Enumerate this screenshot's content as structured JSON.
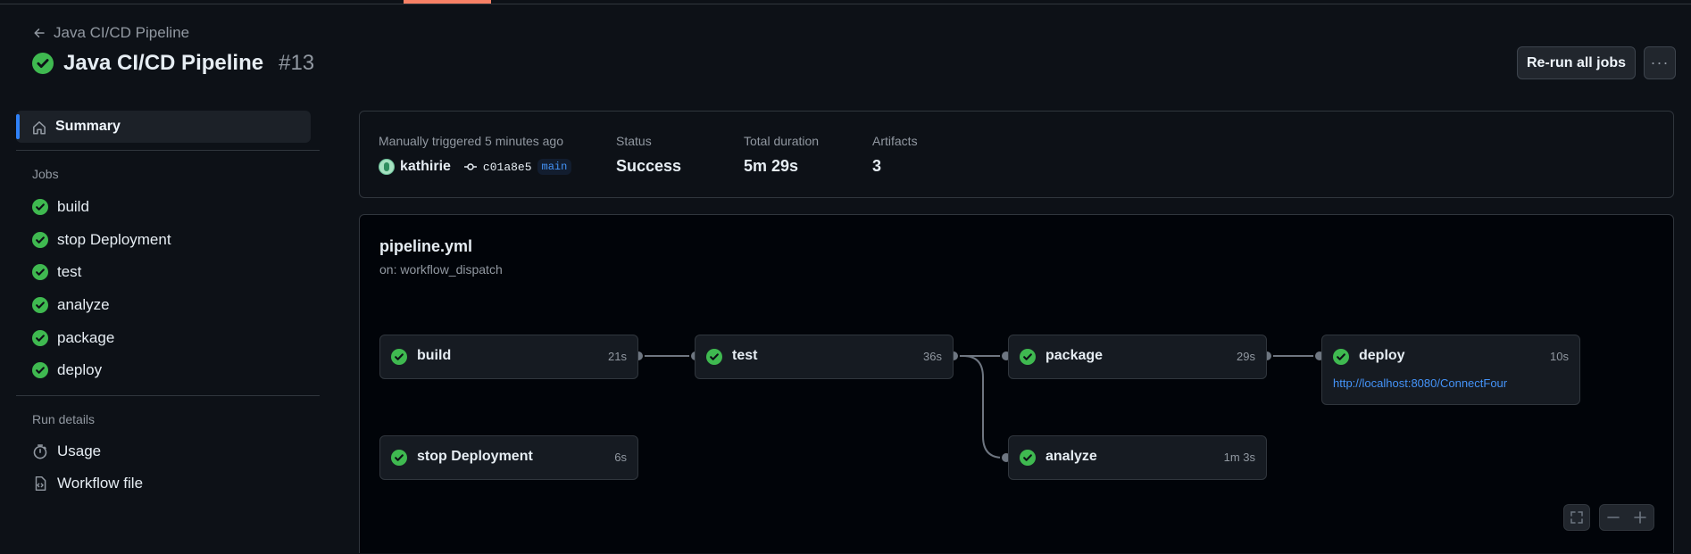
{
  "header": {
    "back_link": "Java CI/CD Pipeline",
    "title": "Java CI/CD Pipeline",
    "run_number": "#13",
    "rerun_label": "Re-run all jobs",
    "more_label": "···"
  },
  "sidebar": {
    "summary_label": "Summary",
    "jobs_heading": "Jobs",
    "jobs": [
      {
        "label": "build"
      },
      {
        "label": "stop Deployment"
      },
      {
        "label": "test"
      },
      {
        "label": "analyze"
      },
      {
        "label": "package"
      },
      {
        "label": "deploy"
      }
    ],
    "run_details_heading": "Run details",
    "run_details": [
      {
        "label": "Usage",
        "icon": "stopwatch-icon"
      },
      {
        "label": "Workflow file",
        "icon": "file-code-icon"
      }
    ]
  },
  "summary": {
    "trigger_label": "Manually triggered 5 minutes ago",
    "actor": "kathirie",
    "commit_sha": "c01a8e5",
    "branch": "main",
    "status_label": "Status",
    "status_value": "Success",
    "duration_label": "Total duration",
    "duration_value": "5m 29s",
    "artifacts_label": "Artifacts",
    "artifacts_value": "3"
  },
  "workflow": {
    "file": "pipeline.yml",
    "trigger": "on: workflow_dispatch",
    "jobs": {
      "build": {
        "name": "build",
        "duration": "21s"
      },
      "test": {
        "name": "test",
        "duration": "36s"
      },
      "package": {
        "name": "package",
        "duration": "29s"
      },
      "deploy": {
        "name": "deploy",
        "duration": "10s",
        "link": "http://localhost:8080/ConnectFour"
      },
      "stop_deployment": {
        "name": "stop Deployment",
        "duration": "6s"
      },
      "analyze": {
        "name": "analyze",
        "duration": "1m 3s"
      }
    }
  },
  "colors": {
    "success": "#3fb950",
    "accent": "#2f81f7",
    "link": "#4493f8",
    "tab_underline": "#f78166"
  }
}
